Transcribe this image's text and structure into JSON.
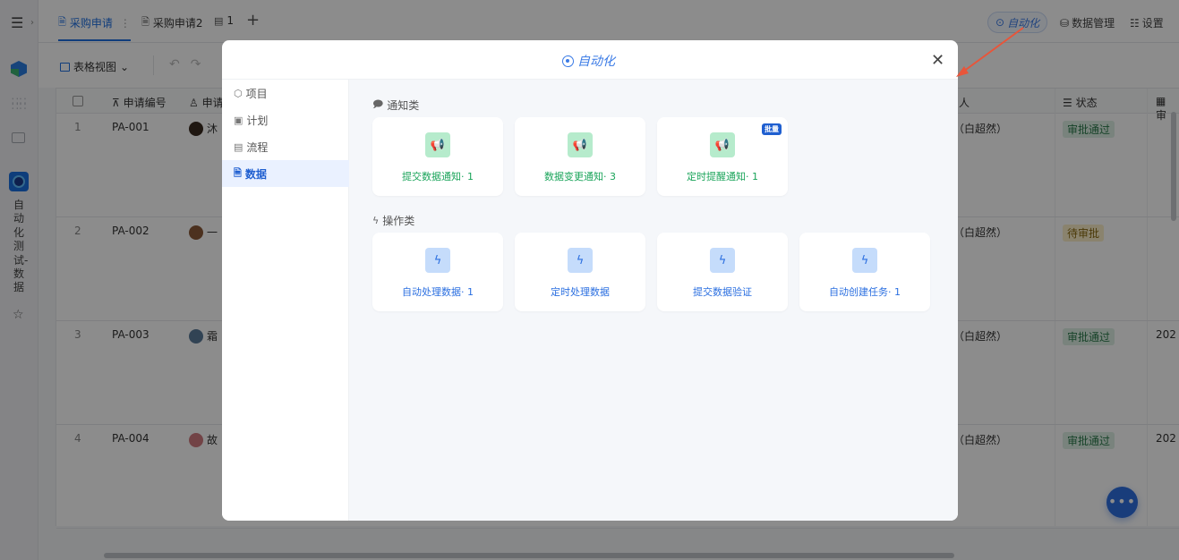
{
  "sidebar": {
    "app_name": "自动化测试-数据",
    "icons": [
      "menu-icon",
      "expand-icon",
      "cube-icon",
      "apps-icon",
      "folder-icon",
      "app-icon",
      "star-icon"
    ]
  },
  "topbar": {
    "tabs": [
      {
        "label": "采购申请",
        "active": true
      },
      {
        "label": "采购申请2",
        "active": false
      },
      {
        "label": "1",
        "active": false
      }
    ],
    "automation_label": "自动化",
    "data_manage_label": "数据管理",
    "settings_label": "设置"
  },
  "toolbar": {
    "view_label": "表格视图"
  },
  "table": {
    "columns": [
      "申请编号",
      "申请",
      "人",
      "状态",
      "审"
    ],
    "rows": [
      {
        "num": "1",
        "code": "PA-001",
        "applicant": "沐",
        "person": "（白超然）",
        "status": "审批通过",
        "status_kind": "ok",
        "extra": ""
      },
      {
        "num": "2",
        "code": "PA-002",
        "applicant": "一",
        "person": "（白超然）",
        "status": "待审批",
        "status_kind": "wait",
        "extra": ""
      },
      {
        "num": "3",
        "code": "PA-003",
        "applicant": "霜",
        "person": "（白超然）",
        "status": "审批通过",
        "status_kind": "ok",
        "extra": "202"
      },
      {
        "num": "4",
        "code": "PA-004",
        "applicant": "故",
        "person": "（白超然）",
        "status": "审批通过",
        "status_kind": "ok",
        "extra": "202"
      }
    ]
  },
  "modal": {
    "title": "自动化",
    "nav": [
      {
        "label": "项目",
        "active": false
      },
      {
        "label": "计划",
        "active": false
      },
      {
        "label": "流程",
        "active": false
      },
      {
        "label": "数据",
        "active": true
      }
    ],
    "sections": [
      {
        "title": "通知类",
        "kind": "notif",
        "cards": [
          {
            "label": "提交数据通知· 1",
            "tag": ""
          },
          {
            "label": "数据变更通知· 3",
            "tag": ""
          },
          {
            "label": "定时提醒通知· 1",
            "tag": "批量"
          }
        ]
      },
      {
        "title": "操作类",
        "kind": "op",
        "cards": [
          {
            "label": "自动处理数据· 1",
            "tag": ""
          },
          {
            "label": "定时处理数据",
            "tag": ""
          },
          {
            "label": "提交数据验证",
            "tag": ""
          },
          {
            "label": "自动创建任务· 1",
            "tag": ""
          }
        ]
      }
    ]
  },
  "colors": {
    "accent": "#3b7be6",
    "notif_icon_bg": "#b6ebcc",
    "notif_text": "#1aa45a",
    "op_icon_bg": "#c5dcfb",
    "op_text": "#2b6fe0",
    "annotation_arrow": "#e8553a"
  }
}
